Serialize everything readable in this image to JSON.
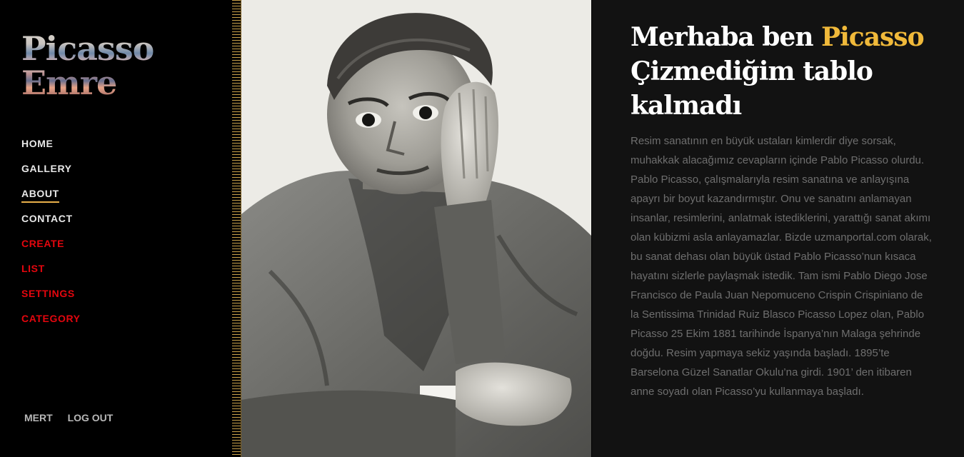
{
  "brand": {
    "line1": "Picasso",
    "line2": "Emre"
  },
  "nav": {
    "items": [
      {
        "label": "HOME"
      },
      {
        "label": "GALLERY"
      },
      {
        "label": "ABOUT"
      },
      {
        "label": "CONTACT"
      },
      {
        "label": "CREATE"
      },
      {
        "label": "LIST"
      },
      {
        "label": "SETTINGS"
      },
      {
        "label": "CATEGORY"
      }
    ],
    "active": "ABOUT"
  },
  "user": {
    "name": "MERT",
    "logout_label": "LOG OUT"
  },
  "hero": {
    "title_prefix": "Merhaba ben ",
    "title_accent": "Picasso",
    "title_line2": "Çizmediğim tablo kalmadı",
    "body": "Resim sanatının en büyük ustaları kimlerdir diye sorsak, muhakkak alacağımız cevapların içinde Pablo Picasso olurdu. Pablo Picasso, çalışmalarıyla resim sanatına ve anlayışına apayrı bir boyut kazandırmıştır. Onu ve sanatını anlamayan insanlar, resimlerini, anlatmak istediklerini, yarattığı sanat akımı olan kübizmi asla anlayamazlar. Bizde uzmanportal.com olarak, bu sanat dehası olan büyük üstad Pablo Picasso’nun kısaca hayatını sizlerle paylaşmak istedik. Tam ismi Pablo Diego Jose Francisco de Paula Juan Nepomuceno Crispin Crispiniano de la Sentissima Trinidad Ruiz Blasco Picasso Lopez olan, Pablo Picasso 25 Ekim 1881 tarihinde İspanya’nın Malaga şehrinde doğdu. Resim yapmaya sekiz yaşında başladı. 1895’te Barselona Güzel Sanatlar Okulu’na girdi. 1901’ den itibaren anne soyadı olan Picasso’yu kullanmaya başladı."
  },
  "colors": {
    "accent": "#f0b93a",
    "nav_highlight": "#e4060e",
    "active_underline": "#e9b04a",
    "content_bg": "#121212",
    "body_text": "#6e6e6e"
  }
}
